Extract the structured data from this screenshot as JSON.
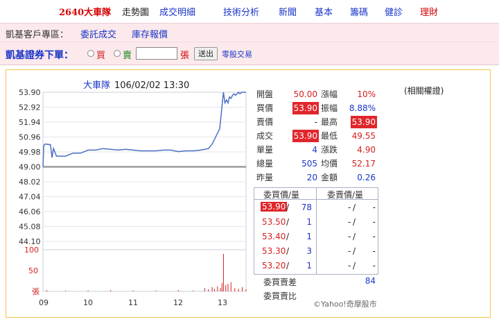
{
  "nav": {
    "stock": "2640大車隊",
    "items": [
      "走勢圖",
      "成交明細",
      "技術分析",
      "新聞",
      "基本",
      "籌碼",
      "健診",
      "理財"
    ]
  },
  "client_zone": {
    "label": "凱基客戶專區：",
    "links": [
      "委託成交",
      "庫存報價"
    ]
  },
  "order": {
    "label": "凱基證券下單：",
    "buy": "買",
    "sell": "賣",
    "qty_value": "",
    "unit": "張",
    "send": "送出",
    "odd_lot": "零股交易"
  },
  "chart": {
    "name": "大車隊",
    "timestamp": "106/02/02 13:30",
    "credit": "©Yahoo!奇摩股市"
  },
  "chart_data": {
    "type": "line",
    "title": "大車隊 106/02/02 13:30",
    "y_ticks": [
      "53.90",
      "52.92",
      "51.94",
      "50.96",
      "49.98",
      "49.00",
      "48.02",
      "47.04",
      "46.06",
      "45.08",
      "44.10"
    ],
    "ylim": [
      44.1,
      53.9
    ],
    "reference_price": 49.0,
    "x_ticks": [
      "09",
      "10",
      "11",
      "12",
      "13"
    ],
    "price_series": {
      "t": [
        0,
        1,
        3,
        10,
        12,
        14,
        18,
        22,
        30,
        40,
        50,
        60,
        70,
        80,
        90,
        100,
        110,
        120,
        130,
        140,
        150,
        160,
        170,
        180,
        190,
        200,
        210,
        220,
        225,
        230,
        235,
        240,
        242,
        244,
        246,
        248,
        250,
        252,
        254,
        256,
        258,
        260,
        262,
        264,
        266,
        268,
        270
      ],
      "price": [
        49.0,
        50.4,
        50.5,
        50.45,
        49.6,
        50.2,
        49.7,
        49.7,
        49.7,
        49.9,
        49.9,
        50.1,
        50.1,
        50.2,
        50.15,
        50.1,
        50.15,
        50.1,
        50.05,
        50.05,
        50.05,
        50.1,
        50.1,
        50.0,
        50.05,
        50.05,
        50.1,
        50.2,
        50.5,
        51.0,
        51.5,
        53.9,
        53.2,
        53.4,
        53.2,
        53.6,
        53.5,
        53.7,
        53.8,
        53.7,
        53.8,
        53.9,
        53.8,
        53.9,
        53.9,
        53.9,
        53.9
      ]
    },
    "volume_ticks": [
      "100",
      "50",
      "張"
    ],
    "volume_series": {
      "t": [
        5,
        30,
        60,
        90,
        120,
        150,
        180,
        200,
        215,
        220,
        225,
        228,
        232,
        236,
        238,
        240,
        243,
        246,
        250,
        255,
        260,
        265,
        270
      ],
      "volume": [
        3,
        2,
        2,
        3,
        2,
        2,
        3,
        2,
        8,
        5,
        10,
        6,
        12,
        8,
        20,
        90,
        15,
        18,
        22,
        8,
        6,
        10,
        5
      ]
    }
  },
  "quote": {
    "open_label": "開盤",
    "open": "50.00",
    "change_label": "漲幅",
    "change": "10%",
    "bid_label": "買價",
    "bid": "53.90",
    "amplitude_label": "振幅",
    "amplitude": "8.88%",
    "ask_label": "賣價",
    "ask": "-",
    "high_label": "最高",
    "high": "53.90",
    "last_label": "成交",
    "last": "53.90",
    "low_label": "最低",
    "low": "49.55",
    "lot_label": "單量",
    "lot": "4",
    "delta_label": "漲跌",
    "delta": "4.90",
    "vol_label": "總量",
    "vol": "505",
    "avg_label": "均價",
    "avg": "52.17",
    "prev_label": "昨量",
    "prev": "20",
    "amount_label": "金額",
    "amount": "0.26"
  },
  "order_book": {
    "bid_header": "委買價/量",
    "ask_header": "委賣價/量",
    "rows": [
      {
        "bid_price": "53.90",
        "bid_qty": "78",
        "ask_price": "-",
        "ask_qty": "-"
      },
      {
        "bid_price": "53.50",
        "bid_qty": "1",
        "ask_price": "-",
        "ask_qty": "-"
      },
      {
        "bid_price": "53.40",
        "bid_qty": "1",
        "ask_price": "-",
        "ask_qty": "-"
      },
      {
        "bid_price": "53.30",
        "bid_qty": "3",
        "ask_price": "-",
        "ask_qty": "-"
      },
      {
        "bid_price": "53.20",
        "bid_qty": "1",
        "ask_price": "-",
        "ask_qty": "-"
      }
    ],
    "diff_label": "委買賣差",
    "diff": "84",
    "ratio_label": "委買賣比",
    "ratio": ""
  },
  "related": "(相關權證)",
  "colors": {
    "price_line": "#4a6fc4",
    "reference": "#9a9a9a",
    "volume": "#d42020",
    "highlight": "#e0262c"
  }
}
